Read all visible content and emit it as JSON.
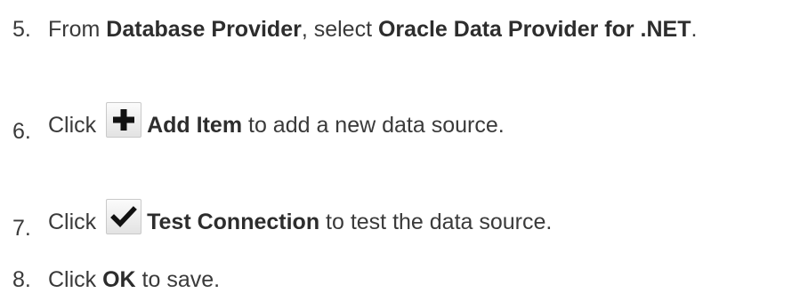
{
  "steps": [
    {
      "number": "5.",
      "text1": "From ",
      "bold1": "Database Provider",
      "text2": ", select ",
      "bold2": "Oracle Data Provider for .NET",
      "text3": "."
    },
    {
      "number": "6.",
      "text1": "Click ",
      "icon": "plus-icon",
      "bold1": "Add Item",
      "text2": " to add a new data source."
    },
    {
      "number": "7.",
      "text1": "Click ",
      "icon": "checkmark-icon",
      "bold1": "Test Connection",
      "text2": " to test the data source."
    },
    {
      "number": "8.",
      "text1": "Click ",
      "bold1": "OK",
      "text2": " to save."
    }
  ],
  "colors": {
    "text": "#3a3a3a",
    "icon_glyph": "#111111",
    "icon_border": "#c9c9c9"
  }
}
